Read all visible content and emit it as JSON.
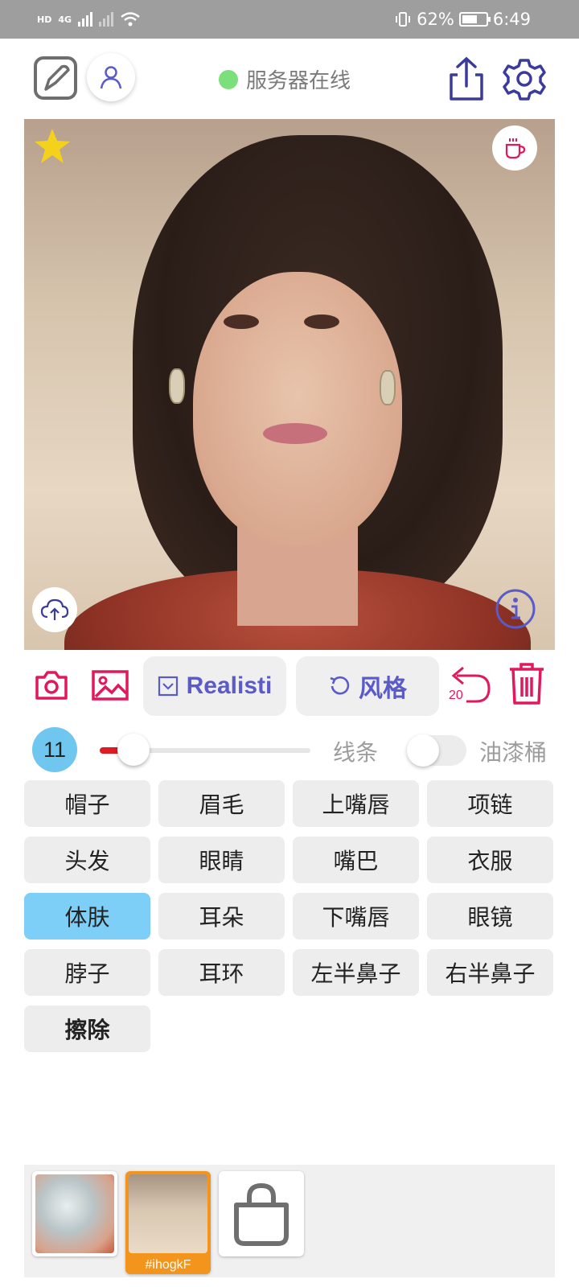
{
  "status_bar": {
    "network_label": "HD",
    "signal_label": "4G",
    "battery_percent": "62%",
    "time": "6:49"
  },
  "top_bar": {
    "server_status": "服务器在线",
    "server_status_color": "#7be07b"
  },
  "canvas": {
    "icons": [
      "star-icon",
      "coffee-icon",
      "upload-cloud-icon",
      "info-icon"
    ]
  },
  "toolbar": {
    "model_button": "Realisti",
    "style_button": "风格",
    "undo_count": "20"
  },
  "brush": {
    "size": "11",
    "slider_fraction": 0.16,
    "line_label": "线条",
    "bucket_label": "油漆桶",
    "bucket_enabled": false
  },
  "parts": [
    {
      "label": "帽子"
    },
    {
      "label": "眉毛"
    },
    {
      "label": "上嘴唇"
    },
    {
      "label": "项链"
    },
    {
      "label": "头发"
    },
    {
      "label": "眼睛"
    },
    {
      "label": "嘴巴"
    },
    {
      "label": "衣服"
    },
    {
      "label": "体肤"
    },
    {
      "label": "耳朵"
    },
    {
      "label": "下嘴唇"
    },
    {
      "label": "眼镜"
    },
    {
      "label": "脖子"
    },
    {
      "label": "耳环"
    },
    {
      "label": "左半鼻子"
    },
    {
      "label": "右半鼻子"
    },
    {
      "label": "擦除"
    }
  ],
  "selected_part": "体肤",
  "tray": {
    "selected_tag": "#ihogkF"
  },
  "colors": {
    "accent_red": "#e0195c",
    "accent_blue": "#5a5ac8",
    "selected_part_bg": "#7dcff7",
    "selected_thumb_border": "#f3941d"
  }
}
